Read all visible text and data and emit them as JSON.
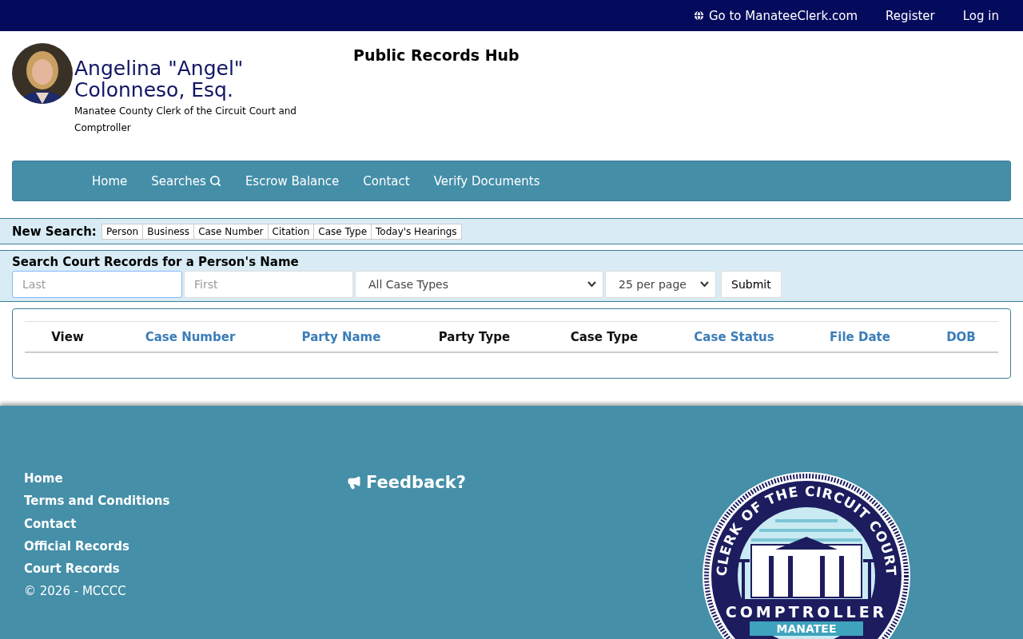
{
  "top_bar": {
    "links": [
      {
        "label": "Go to ManateeClerk.com",
        "kind": "globe"
      },
      {
        "label": "Register",
        "kind": "plain"
      },
      {
        "label": "Log in",
        "kind": "plain"
      }
    ]
  },
  "header": {
    "name": "Angelina \"Angel\" Colonneso, Esq.",
    "subtitle": "Manatee County Clerk of the Circuit Court and Comptroller",
    "title": "Public Records Hub"
  },
  "nav": {
    "items": [
      {
        "label": "Home",
        "kind": "plain"
      },
      {
        "label": "Searches",
        "kind": "search"
      },
      {
        "label": "Escrow Balance",
        "kind": "plain"
      },
      {
        "label": "Contact",
        "kind": "plain"
      },
      {
        "label": "Verify Documents",
        "kind": "plain"
      }
    ]
  },
  "new_search": {
    "label": "New Search:",
    "tabs": [
      "Person",
      "Business",
      "Case Number",
      "Citation",
      "Case Type",
      "Today's Hearings"
    ]
  },
  "search_form": {
    "title": "Search Court Records for a Person's Name",
    "last": {
      "placeholder": "Last"
    },
    "first": {
      "placeholder": "First"
    },
    "case_type": "All Case Types",
    "per_page": "25 per page",
    "submit": "Submit"
  },
  "table": {
    "columns": [
      {
        "label": "View",
        "sortable": false
      },
      {
        "label": "Case Number",
        "sortable": true
      },
      {
        "label": "Party Name",
        "sortable": true
      },
      {
        "label": "Party Type",
        "sortable": false
      },
      {
        "label": "Case Type",
        "sortable": false
      },
      {
        "label": "Case Status",
        "sortable": true
      },
      {
        "label": "File Date",
        "sortable": true
      },
      {
        "label": "DOB",
        "sortable": true
      }
    ]
  },
  "footer": {
    "links": [
      "Home",
      "Terms and Conditions",
      "Contact",
      "Official Records",
      "Court Records"
    ],
    "copyright": "© 2026 - MCCCC",
    "feedback": "Feedback?",
    "seal": {
      "ring_text": "CLERK OF THE CIRCUIT COURT",
      "band_text": "COMPTROLLER",
      "bottom_text": "MANATEE"
    }
  }
}
